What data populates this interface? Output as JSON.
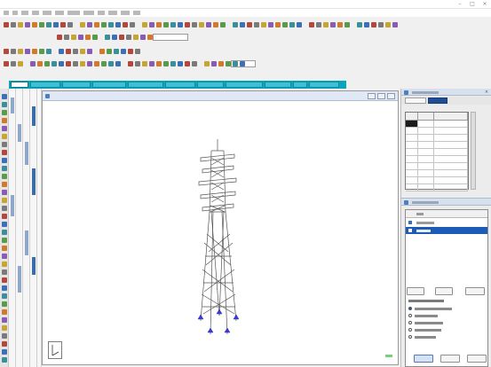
{
  "app": {
    "title": "",
    "window_controls": [
      "–",
      "□",
      "×"
    ]
  },
  "menubar": {
    "items": [
      "",
      "",
      "",
      "",
      "",
      "",
      "",
      "",
      "",
      "",
      "",
      ""
    ]
  },
  "toolbars": {
    "combo_1_value": "",
    "combo_2_value": ""
  },
  "ribbon": {
    "tabs": [
      "",
      "",
      "",
      "",
      "",
      "",
      "",
      "",
      "",
      "",
      ""
    ],
    "active_tab_index": 0
  },
  "vertical_tabs": [
    "",
    "",
    "",
    "",
    ""
  ],
  "viewport": {
    "title": "",
    "status": ""
  },
  "properties_panel": {
    "title": "",
    "tabs": [
      "",
      ""
    ],
    "columns": [
      "",
      "",
      ""
    ],
    "row_count": 10
  },
  "support_panel": {
    "title": "",
    "list_header": "",
    "items": [
      "",
      ""
    ],
    "selected_index": 1,
    "buttons": [
      "",
      "",
      ""
    ],
    "options_title": "",
    "options": [
      "",
      "",
      "",
      "",
      ""
    ],
    "selected_option": 0,
    "footer_buttons": [
      "",
      "",
      ""
    ]
  },
  "colors": {
    "ribbon": "#0aa5bd",
    "ribbon_active": "#ffffff",
    "selection": "#1e5bb6",
    "tower_line": "#555555",
    "support": "#3a3adf"
  },
  "icons": [
    "new-icon",
    "open-icon",
    "save-icon",
    "print-icon",
    "undo-icon",
    "redo-icon",
    "zoom-icon",
    "pan-icon",
    "rotate-icon",
    "select-icon",
    "node-icon",
    "beam-icon",
    "plate-icon",
    "support-icon",
    "load-icon",
    "help-icon"
  ]
}
